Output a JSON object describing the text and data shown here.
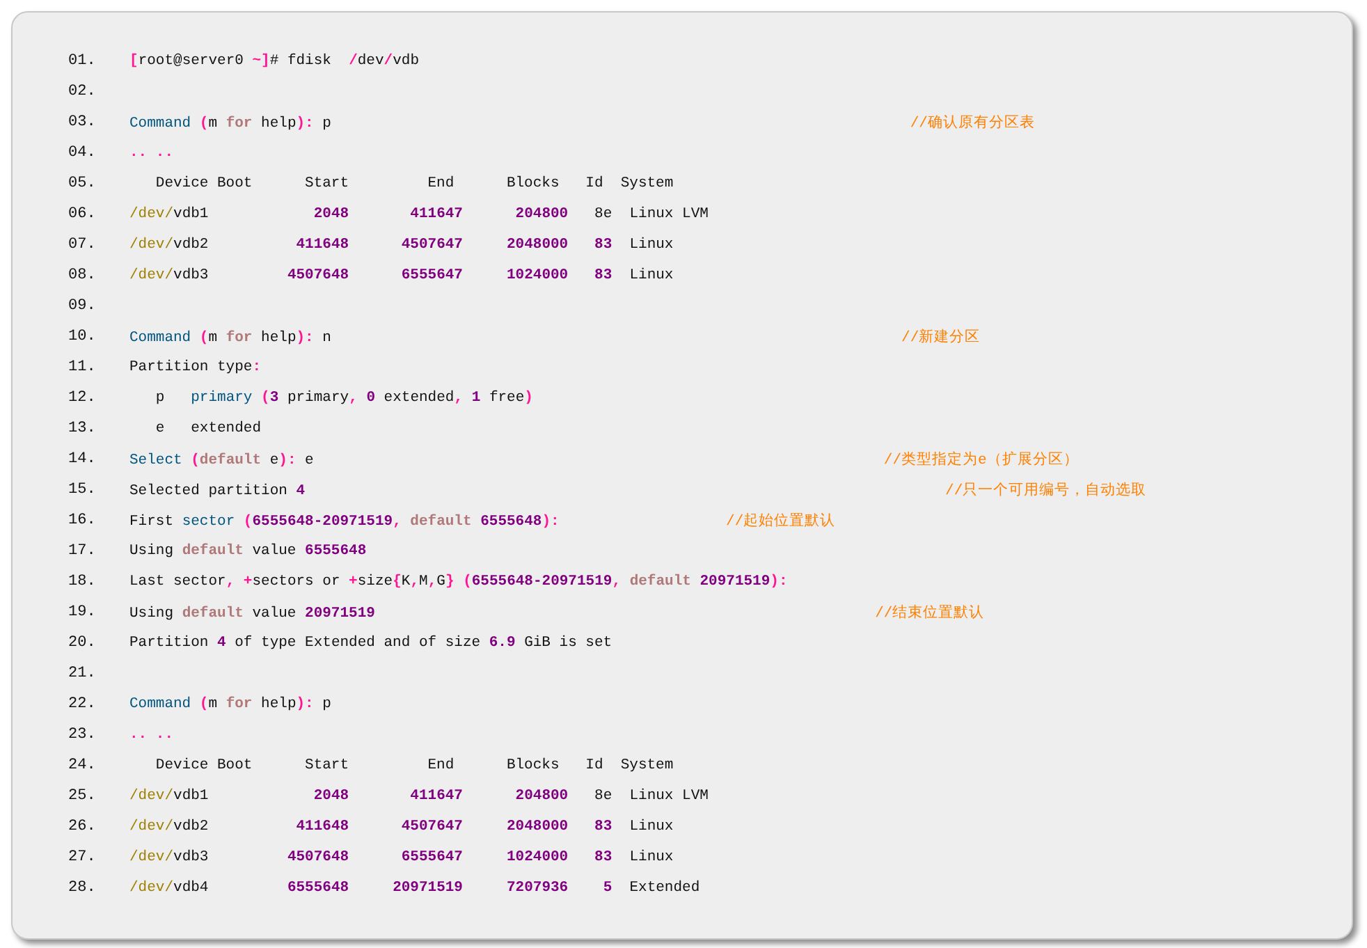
{
  "listing": {
    "lines": [
      {
        "number": "01.",
        "tokens": [
          {
            "kind": "punct",
            "text": "["
          },
          {
            "kind": "plain",
            "text": "root@server0 "
          },
          {
            "kind": "punct",
            "text": "~]"
          },
          {
            "kind": "plain",
            "text": "# fdisk  "
          },
          {
            "kind": "punct",
            "text": "/"
          },
          {
            "kind": "plain",
            "text": "dev"
          },
          {
            "kind": "punct",
            "text": "/"
          },
          {
            "kind": "plain",
            "text": "vdb"
          }
        ]
      },
      {
        "number": "02."
      },
      {
        "number": "03.",
        "tokens": [
          {
            "kind": "key",
            "text": "Command"
          },
          {
            "kind": "punct",
            "text": " ("
          },
          {
            "kind": "plain",
            "text": "m "
          },
          {
            "kind": "builtin",
            "text": "for"
          },
          {
            "kind": "plain",
            "text": " help"
          },
          {
            "kind": "punct",
            "text": "):"
          },
          {
            "kind": "plain",
            "text": " p"
          },
          {
            "kind": "comment",
            "text": "                                                                  //确认原有分区表"
          }
        ]
      },
      {
        "number": "04.",
        "tokens": [
          {
            "kind": "punct",
            "text": ".. .."
          }
        ]
      },
      {
        "number": "05.",
        "tokens": [
          {
            "kind": "plain",
            "text": "   Device Boot      Start         End      Blocks   Id  System"
          }
        ]
      },
      {
        "number": "06.",
        "tokens": [
          {
            "kind": "path",
            "text": "/dev/"
          },
          {
            "kind": "plain",
            "text": "vdb1"
          },
          {
            "kind": "num",
            "text": "            2048"
          },
          {
            "kind": "num",
            "text": "       411647"
          },
          {
            "kind": "num",
            "text": "      204800"
          },
          {
            "kind": "plain",
            "text": "   8e  Linux LVM"
          }
        ]
      },
      {
        "number": "07.",
        "tokens": [
          {
            "kind": "path",
            "text": "/dev/"
          },
          {
            "kind": "plain",
            "text": "vdb2"
          },
          {
            "kind": "num",
            "text": "          411648"
          },
          {
            "kind": "num",
            "text": "      4507647"
          },
          {
            "kind": "num",
            "text": "     2048000"
          },
          {
            "kind": "num",
            "text": "   83"
          },
          {
            "kind": "plain",
            "text": "  Linux"
          }
        ]
      },
      {
        "number": "08.",
        "tokens": [
          {
            "kind": "path",
            "text": "/dev/"
          },
          {
            "kind": "plain",
            "text": "vdb3"
          },
          {
            "kind": "num",
            "text": "         4507648"
          },
          {
            "kind": "num",
            "text": "      6555647"
          },
          {
            "kind": "num",
            "text": "     1024000"
          },
          {
            "kind": "num",
            "text": "   83"
          },
          {
            "kind": "plain",
            "text": "  Linux"
          }
        ]
      },
      {
        "number": "09."
      },
      {
        "number": "10.",
        "tokens": [
          {
            "kind": "key",
            "text": "Command"
          },
          {
            "kind": "punct",
            "text": " ("
          },
          {
            "kind": "plain",
            "text": "m "
          },
          {
            "kind": "builtin",
            "text": "for"
          },
          {
            "kind": "plain",
            "text": " help"
          },
          {
            "kind": "punct",
            "text": "):"
          },
          {
            "kind": "plain",
            "text": " n"
          },
          {
            "kind": "comment",
            "text": "                                                                 //新建分区"
          }
        ]
      },
      {
        "number": "11.",
        "tokens": [
          {
            "kind": "plain",
            "text": "Partition type"
          },
          {
            "kind": "punct",
            "text": ":"
          }
        ]
      },
      {
        "number": "12.",
        "tokens": [
          {
            "kind": "plain",
            "text": "   p"
          },
          {
            "kind": "key",
            "text": "   primary"
          },
          {
            "kind": "punct",
            "text": " ("
          },
          {
            "kind": "num",
            "text": "3"
          },
          {
            "kind": "plain",
            "text": " primary"
          },
          {
            "kind": "punct",
            "text": ","
          },
          {
            "kind": "num",
            "text": " 0"
          },
          {
            "kind": "plain",
            "text": " extended"
          },
          {
            "kind": "punct",
            "text": ","
          },
          {
            "kind": "num",
            "text": " 1"
          },
          {
            "kind": "plain",
            "text": " free"
          },
          {
            "kind": "punct",
            "text": ")"
          }
        ]
      },
      {
        "number": "13.",
        "tokens": [
          {
            "kind": "plain",
            "text": "   e   extended"
          }
        ]
      },
      {
        "number": "14.",
        "tokens": [
          {
            "kind": "key",
            "text": "Select"
          },
          {
            "kind": "punct",
            "text": " ("
          },
          {
            "kind": "builtin",
            "text": "default"
          },
          {
            "kind": "plain",
            "text": " e"
          },
          {
            "kind": "punct",
            "text": "):"
          },
          {
            "kind": "plain",
            "text": " e"
          },
          {
            "kind": "comment",
            "text": "                                                                 //类型指定为e（扩展分区）"
          }
        ]
      },
      {
        "number": "15.",
        "tokens": [
          {
            "kind": "plain",
            "text": "Selected partition "
          },
          {
            "kind": "num",
            "text": "4"
          },
          {
            "kind": "comment",
            "text": "                                                                         //只一个可用编号，自动选取"
          }
        ]
      },
      {
        "number": "16.",
        "tokens": [
          {
            "kind": "plain",
            "text": "First "
          },
          {
            "kind": "key",
            "text": "sector"
          },
          {
            "kind": "punct",
            "text": " ("
          },
          {
            "kind": "num",
            "text": "6555648-20971519"
          },
          {
            "kind": "punct",
            "text": ","
          },
          {
            "kind": "builtin",
            "text": " default"
          },
          {
            "kind": "num",
            "text": " 6555648"
          },
          {
            "kind": "punct",
            "text": "):"
          },
          {
            "kind": "comment",
            "text": "                   //起始位置默认"
          }
        ]
      },
      {
        "number": "17.",
        "tokens": [
          {
            "kind": "plain",
            "text": "Using "
          },
          {
            "kind": "builtin",
            "text": "default"
          },
          {
            "kind": "plain",
            "text": " value "
          },
          {
            "kind": "num",
            "text": "6555648"
          }
        ]
      },
      {
        "number": "18.",
        "tokens": [
          {
            "kind": "plain",
            "text": "Last sector"
          },
          {
            "kind": "punct",
            "text": ","
          },
          {
            "kind": "punct",
            "text": " +"
          },
          {
            "kind": "plain",
            "text": "sectors or "
          },
          {
            "kind": "punct",
            "text": "+"
          },
          {
            "kind": "plain",
            "text": "size"
          },
          {
            "kind": "punct",
            "text": "{"
          },
          {
            "kind": "plain",
            "text": "K"
          },
          {
            "kind": "punct",
            "text": ","
          },
          {
            "kind": "plain",
            "text": "M"
          },
          {
            "kind": "punct",
            "text": ","
          },
          {
            "kind": "plain",
            "text": "G"
          },
          {
            "kind": "punct",
            "text": "}"
          },
          {
            "kind": "punct",
            "text": " ("
          },
          {
            "kind": "num",
            "text": "6555648-20971519"
          },
          {
            "kind": "punct",
            "text": ","
          },
          {
            "kind": "builtin",
            "text": " default"
          },
          {
            "kind": "num",
            "text": " 20971519"
          },
          {
            "kind": "punct",
            "text": "):"
          }
        ]
      },
      {
        "number": "19.",
        "tokens": [
          {
            "kind": "plain",
            "text": "Using "
          },
          {
            "kind": "builtin",
            "text": "default"
          },
          {
            "kind": "plain",
            "text": " value "
          },
          {
            "kind": "num",
            "text": "20971519"
          },
          {
            "kind": "comment",
            "text": "                                                         //结束位置默认"
          }
        ]
      },
      {
        "number": "20.",
        "tokens": [
          {
            "kind": "plain",
            "text": "Partition "
          },
          {
            "kind": "num",
            "text": "4"
          },
          {
            "kind": "plain",
            "text": " of type Extended and of size "
          },
          {
            "kind": "num",
            "text": "6.9"
          },
          {
            "kind": "plain",
            "text": " GiB is set"
          }
        ]
      },
      {
        "number": "21."
      },
      {
        "number": "22.",
        "tokens": [
          {
            "kind": "key",
            "text": "Command"
          },
          {
            "kind": "punct",
            "text": " ("
          },
          {
            "kind": "plain",
            "text": "m "
          },
          {
            "kind": "builtin",
            "text": "for"
          },
          {
            "kind": "plain",
            "text": " help"
          },
          {
            "kind": "punct",
            "text": "):"
          },
          {
            "kind": "plain",
            "text": " p"
          }
        ]
      },
      {
        "number": "23.",
        "tokens": [
          {
            "kind": "punct",
            "text": ".. .."
          }
        ]
      },
      {
        "number": "24.",
        "tokens": [
          {
            "kind": "plain",
            "text": "   Device Boot      Start         End      Blocks   Id  System"
          }
        ]
      },
      {
        "number": "25.",
        "tokens": [
          {
            "kind": "path",
            "text": "/dev/"
          },
          {
            "kind": "plain",
            "text": "vdb1"
          },
          {
            "kind": "num",
            "text": "            2048"
          },
          {
            "kind": "num",
            "text": "       411647"
          },
          {
            "kind": "num",
            "text": "      204800"
          },
          {
            "kind": "plain",
            "text": "   8e  Linux LVM"
          }
        ]
      },
      {
        "number": "26.",
        "tokens": [
          {
            "kind": "path",
            "text": "/dev/"
          },
          {
            "kind": "plain",
            "text": "vdb2"
          },
          {
            "kind": "num",
            "text": "          411648"
          },
          {
            "kind": "num",
            "text": "      4507647"
          },
          {
            "kind": "num",
            "text": "     2048000"
          },
          {
            "kind": "num",
            "text": "   83"
          },
          {
            "kind": "plain",
            "text": "  Linux"
          }
        ]
      },
      {
        "number": "27.",
        "tokens": [
          {
            "kind": "path",
            "text": "/dev/"
          },
          {
            "kind": "plain",
            "text": "vdb3"
          },
          {
            "kind": "num",
            "text": "         4507648"
          },
          {
            "kind": "num",
            "text": "      6555647"
          },
          {
            "kind": "num",
            "text": "     1024000"
          },
          {
            "kind": "num",
            "text": "   83"
          },
          {
            "kind": "plain",
            "text": "  Linux"
          }
        ]
      },
      {
        "number": "28.",
        "tokens": [
          {
            "kind": "path",
            "text": "/dev/"
          },
          {
            "kind": "plain",
            "text": "vdb4"
          },
          {
            "kind": "num",
            "text": "         6555648"
          },
          {
            "kind": "num",
            "text": "     20971519"
          },
          {
            "kind": "num",
            "text": "     7207936"
          },
          {
            "kind": "num",
            "text": "    5"
          },
          {
            "kind": "plain",
            "text": "  Extended"
          }
        ]
      }
    ]
  }
}
